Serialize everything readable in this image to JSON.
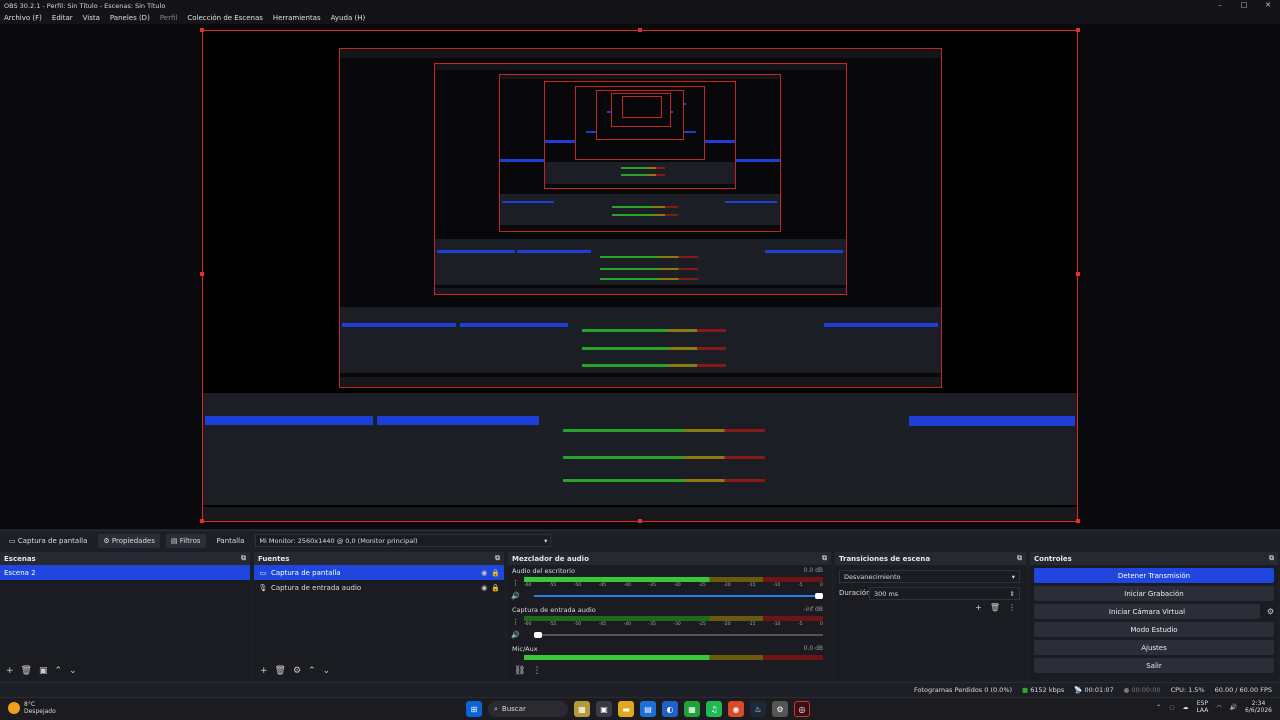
{
  "window": {
    "title": "OBS 30.2.1 - Perfil: Sin Título - Escenas: Sin Título",
    "minimize": "–",
    "maximize": "□",
    "close": "✕"
  },
  "menu": {
    "archivo": "Archivo (F)",
    "editar": "Editar",
    "vista": "Vista",
    "paneles": "Paneles (D)",
    "perfil": "Perfil",
    "coleccion": "Colección de Escenas",
    "herramientas": "Herramientas",
    "ayuda": "Ayuda (H)"
  },
  "source_bar": {
    "source_name": "Captura de pantalla",
    "properties": "Propiedades",
    "filters": "Filtros",
    "display_label": "Pantalla",
    "display_value": "Mi Monitor: 2560x1440 @ 0,0 (Monitor principal)"
  },
  "scenes": {
    "title": "Escenas",
    "items": [
      "Escena 2"
    ]
  },
  "sources": {
    "title": "Fuentes",
    "items": [
      "Captura de pantalla",
      "Captura de entrada audio"
    ]
  },
  "mixer": {
    "title": "Mezclador de audio",
    "scale": [
      "-60",
      "-55",
      "-50",
      "-45",
      "-40",
      "-35",
      "-30",
      "-25",
      "-20",
      "-15",
      "-10",
      "-5",
      "0"
    ],
    "channels": [
      {
        "name": "Audio del escritorio",
        "db": "0.0 dB"
      },
      {
        "name": "Captura de entrada audio",
        "db": "-inf dB"
      },
      {
        "name": "Mic/Aux",
        "db": "0.0 dB"
      }
    ]
  },
  "transitions": {
    "title": "Transiciones de escena",
    "selected": "Desvanecimiento",
    "duration_label": "Duración",
    "duration_value": "300 ms"
  },
  "controls": {
    "title": "Controles",
    "buttons": [
      "Detener Transmisión",
      "Iniciar Grabación",
      "Iniciar Cámara Virtual",
      "Modo Estudio",
      "Ajustes",
      "Salir"
    ]
  },
  "status": {
    "dropped": "Fotogramas Perdidos 0 (0.0%)",
    "bitrate": "6152 kbps",
    "stream_time": "00:01:07",
    "rec_time": "00:00:00",
    "cpu": "CPU: 1.5%",
    "fps": "60.00 / 60.00 FPS"
  },
  "taskbar": {
    "temp": "8°C",
    "weather": "Despejado",
    "search": "Buscar",
    "lang1": "ESP",
    "lang2": "LAA",
    "time": "2:34",
    "date": "6/6/2026"
  },
  "colors": {
    "accent": "#1f47e0",
    "border_red": "#d92a2a",
    "dock_bg": "#1a1c22"
  }
}
